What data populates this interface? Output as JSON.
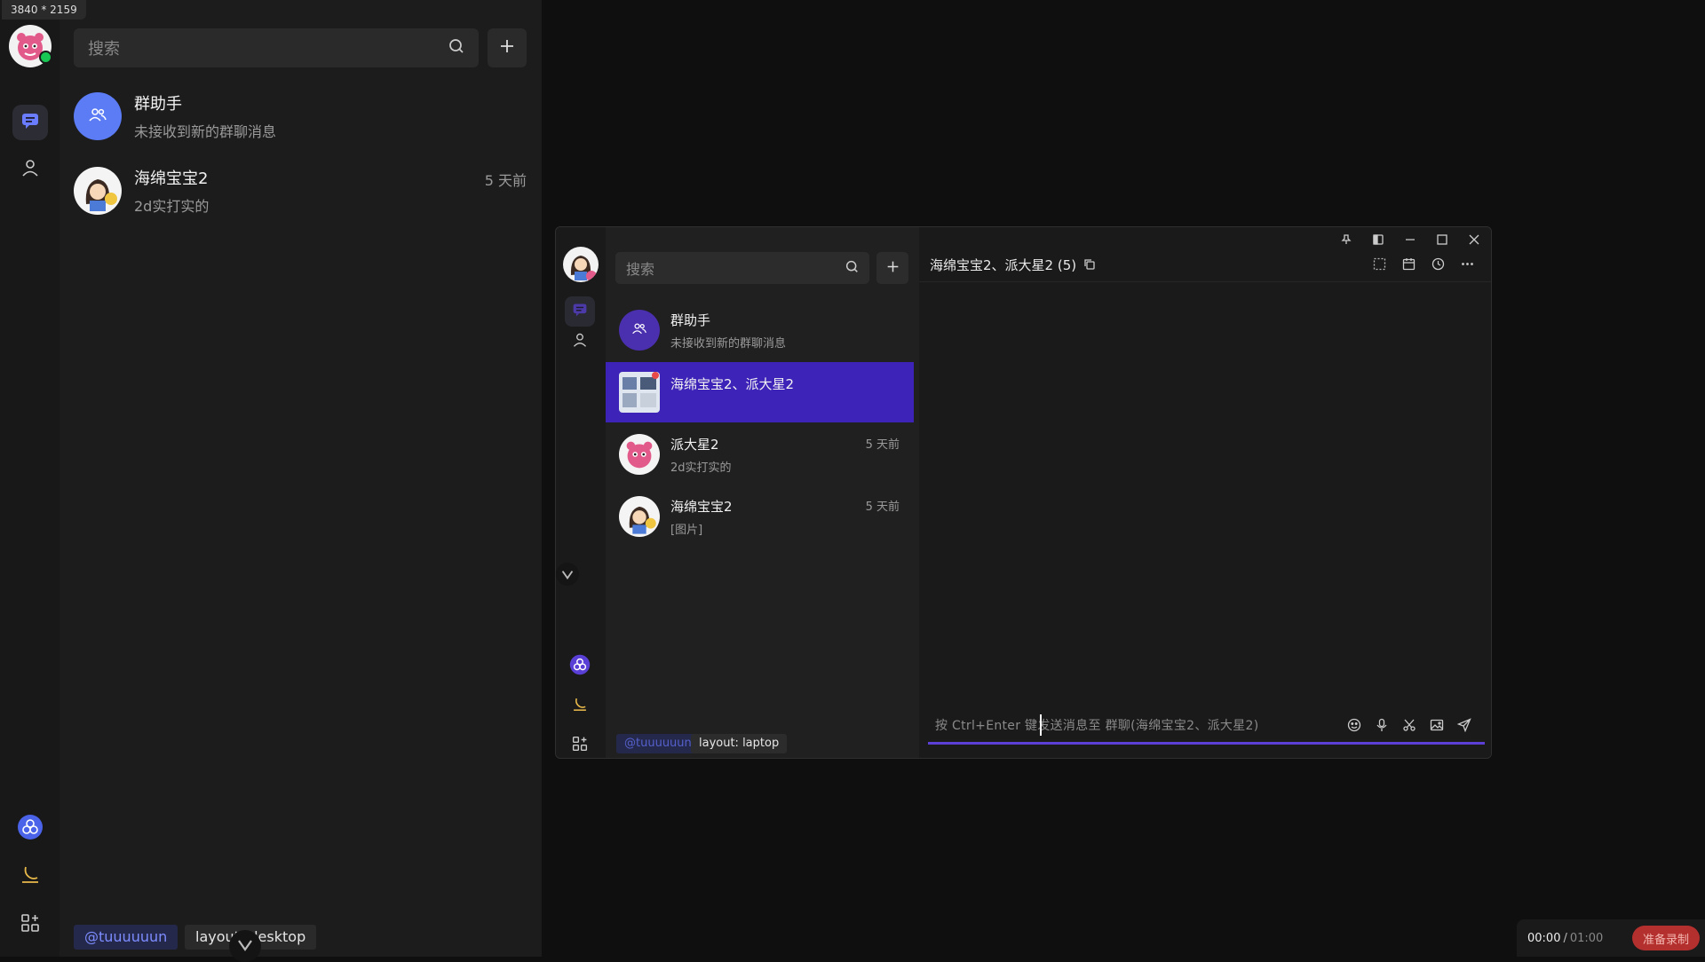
{
  "screen": {
    "dimensions_label": "3840 * 2159"
  },
  "desktop_app": {
    "search": {
      "placeholder": "搜索"
    },
    "conversations": [
      {
        "name": "群助手",
        "subtitle": "未接收到新的群聊消息",
        "time": ""
      },
      {
        "name": "海绵宝宝2",
        "subtitle": "2d实打实的",
        "time": "5 天前"
      }
    ],
    "tags": {
      "user": "@tuuuuuun",
      "layout": "layout: desktop"
    }
  },
  "laptop_window": {
    "search": {
      "placeholder": "搜索"
    },
    "conversations": [
      {
        "name": "群助手",
        "subtitle": "未接收到新的群聊消息",
        "time": "",
        "selected": false
      },
      {
        "name": "海绵宝宝2、派大星2",
        "subtitle": "",
        "time": "",
        "selected": true
      },
      {
        "name": "派大星2",
        "subtitle": "2d实打实的",
        "time": "5 天前",
        "selected": false
      },
      {
        "name": "海绵宝宝2",
        "subtitle": "[图片]",
        "time": "5 天前",
        "selected": false
      }
    ],
    "chat": {
      "title": "海绵宝宝2、派大星2 (5)",
      "input_placeholder": "按 Ctrl+Enter 键发送消息至 群聊(海绵宝宝2、派大星2)"
    },
    "tags": {
      "user": "@tuuuuuun",
      "layout": "layout: laptop"
    }
  },
  "recorder": {
    "current": "00:00",
    "separator": "/",
    "total": "01:00",
    "button": "准备录制"
  },
  "colors": {
    "accent": "#3d23b8",
    "group_avatar": "#5b7cf5",
    "online": "#17c653",
    "record": "#b4302e",
    "user_tag_text": "#7d8cff"
  }
}
